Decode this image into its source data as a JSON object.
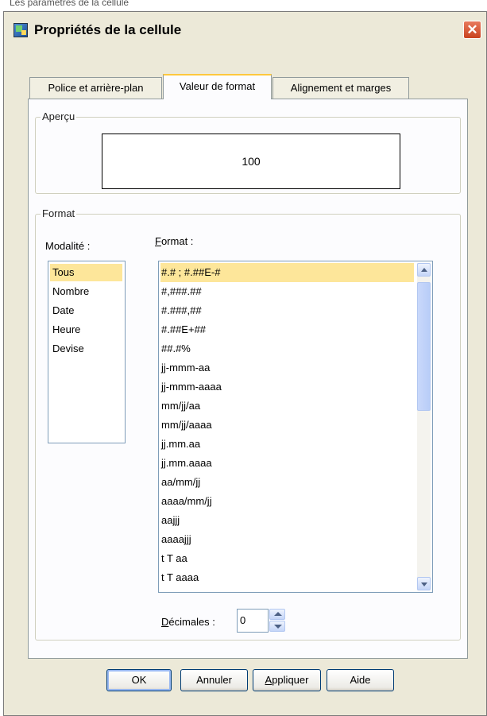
{
  "top_fragment": "Les paramètres de la cellule",
  "dialog": {
    "title": "Propriétés de la cellule",
    "close_glyph": "✕"
  },
  "tabs": [
    {
      "label": "Police et arrière-plan",
      "active": false
    },
    {
      "label": "Valeur de format",
      "active": true
    },
    {
      "label": "Alignement et marges",
      "active": false
    }
  ],
  "preview": {
    "legend": "Aperçu",
    "value": "100"
  },
  "format_group": {
    "legend": "Format",
    "modality_label": "Modalité :",
    "format_label_first": "F",
    "format_label_rest": "ormat :",
    "modality_items": [
      "Tous",
      "Nombre",
      "Date",
      "Heure",
      "Devise"
    ],
    "modality_selected": "Tous",
    "format_items": [
      "#.# ; #.##E-#",
      "#,###.##",
      "#.###,##",
      "#.##E+##",
      "##.#%",
      "jj-mmm-aa",
      "jj-mmm-aaaa",
      "mm/jj/aa",
      "mm/jj/aaaa",
      "jj.mm.aa",
      "jj.mm.aaaa",
      "aa/mm/jj",
      "aaaa/mm/jj",
      "aajjj",
      "aaaajjj",
      "t T aa",
      "t T aaaa"
    ],
    "format_selected": "#.# ; #.##E-#",
    "decimals_label_first": "D",
    "decimals_label_rest": "écimales :",
    "decimals_value": "0"
  },
  "buttons": {
    "ok": "OK",
    "cancel": "Annuler",
    "apply_first": "A",
    "apply_rest": "ppliquer",
    "help": "Aide"
  },
  "colors": {
    "dialog_bg": "#ece9d8",
    "selection": "#fde69a",
    "active_tab_accent": "#ffc83c",
    "close_button": "#c9421e"
  }
}
